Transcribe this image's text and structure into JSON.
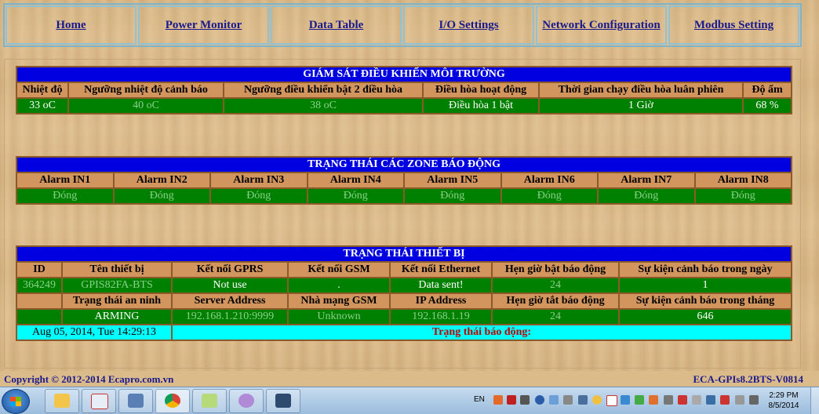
{
  "nav": [
    "Home",
    "Power Monitor",
    "Data Table",
    "I/O Settings",
    "Network Configuration",
    "Modbus Setting"
  ],
  "env": {
    "title": "GIÁM SÁT ĐIỀU KHIỂN MÔI TRƯỜNG",
    "headers": [
      "Nhiệt độ",
      "Ngưỡng nhiệt độ cảnh báo",
      "Ngưỡng điều khiển bật 2 điều hòa",
      "Điều hòa hoạt động",
      "Thời gian chạy điều hòa luân phiên",
      "Độ ẩm"
    ],
    "values": [
      "33 oC",
      "40 oC",
      "38 oC",
      "Điều hòa 1 bật",
      "1 Giờ",
      "68 %"
    ]
  },
  "zone": {
    "title": "TRẠNG THÁI CÁC ZONE BÁO ĐỘNG",
    "headers": [
      "Alarm IN1",
      "Alarm IN2",
      "Alarm IN3",
      "Alarm IN4",
      "Alarm IN5",
      "Alarm IN6",
      "Alarm IN7",
      "Alarm IN8"
    ],
    "values": [
      "Đóng",
      "Đóng",
      "Đóng",
      "Đóng",
      "Đóng",
      "Đóng",
      "Đóng",
      "Đóng"
    ]
  },
  "device": {
    "title": "TRẠNG THÁI THIẾT BỊ",
    "headers1": [
      "ID",
      "Tên thiết bị",
      "Kết nối GPRS",
      "Kết nối GSM",
      "Kết nối Ethernet",
      "Hẹn giờ bật báo động",
      "Sự kiện cảnh báo trong ngày"
    ],
    "values1": [
      "364249",
      "GPIS82FA-BTS",
      "Not use",
      ".",
      "Data sent!",
      "24",
      "1"
    ],
    "headers2": [
      "",
      "Trạng thái an ninh",
      "Server Address",
      "Nhà mạng GSM",
      "IP Address",
      "Hẹn giờ tắt báo động",
      "Sự kiện cảnh báo trong tháng"
    ],
    "values2": [
      "",
      "ARMING",
      "192.168.1.210:9999",
      "Unknown",
      "192.168.1.19",
      "24",
      "646"
    ],
    "datetime": "Aug 05, 2014, Tue 14:29:13",
    "alarm_status": "Trạng thái báo động:"
  },
  "footer": {
    "copyright": "Copyright © 2012-2014 Ecapro.com.vn",
    "version": "ECA-GPIs8.2BTS-V0814"
  },
  "taskbar": {
    "apps": [
      "folder-icon",
      "network-icon",
      "user-switch-icon",
      "chrome-icon",
      "files-icon",
      "paint-icon",
      "window-app-icon"
    ],
    "lang": "EN",
    "time": "2:29 PM",
    "date": "8/5/2014"
  }
}
